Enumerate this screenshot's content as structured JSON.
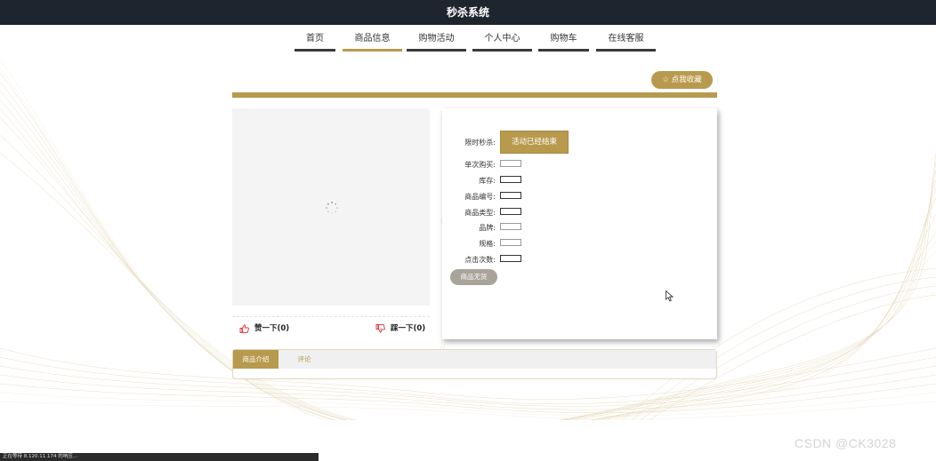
{
  "header": {
    "title": "秒杀系统"
  },
  "nav": {
    "items": [
      {
        "label": "首页"
      },
      {
        "label": "商品信息",
        "active": true
      },
      {
        "label": "购物活动"
      },
      {
        "label": "个人中心"
      },
      {
        "label": "购物车"
      },
      {
        "label": "在线客服"
      }
    ]
  },
  "favorite": {
    "label": "☆ 点我收藏"
  },
  "votes": {
    "like": "赞一下(0)",
    "dislike": "踩一下(0)"
  },
  "product": {
    "flash_sale_label": "限时秒杀:",
    "flash_sale_status": "活动已经结束",
    "fields": [
      {
        "label": "单次购买:"
      },
      {
        "label": "库存:"
      },
      {
        "label": "商品编号:"
      },
      {
        "label": "商品类型:"
      },
      {
        "label": "品牌:"
      },
      {
        "label": "规格:"
      },
      {
        "label": "点击次数:"
      }
    ],
    "no_stock_button": "商品无货"
  },
  "tabs": [
    {
      "label": "商品介绍",
      "active": true
    },
    {
      "label": "评论"
    }
  ],
  "status_bar": {
    "text": "正在等待 8.120.11.174 的响应..."
  },
  "watermark": {
    "text": "CSDN @CK3028"
  },
  "colors": {
    "accent": "#b89a4e",
    "topbar": "#1f252e"
  }
}
